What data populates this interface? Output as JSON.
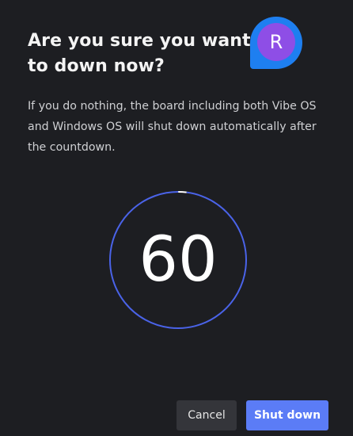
{
  "dialog": {
    "title": "Are you sure you want to down now?",
    "description": "If you do nothing, the board including both Vibe OS and Windows OS will shut down automatically after the countdown.",
    "avatar_initial": "R"
  },
  "countdown": {
    "value": "60",
    "remaining_fraction": 0.98,
    "ring_color": "#4a63e8",
    "elapsed_color": "#ffffff"
  },
  "buttons": {
    "cancel_label": "Cancel",
    "shutdown_label": "Shut down"
  },
  "colors": {
    "background": "#1d1e22",
    "primary": "#5b7cf6",
    "avatar_outer": "#1e7ff0",
    "avatar_inner": "#8e4ee6"
  }
}
